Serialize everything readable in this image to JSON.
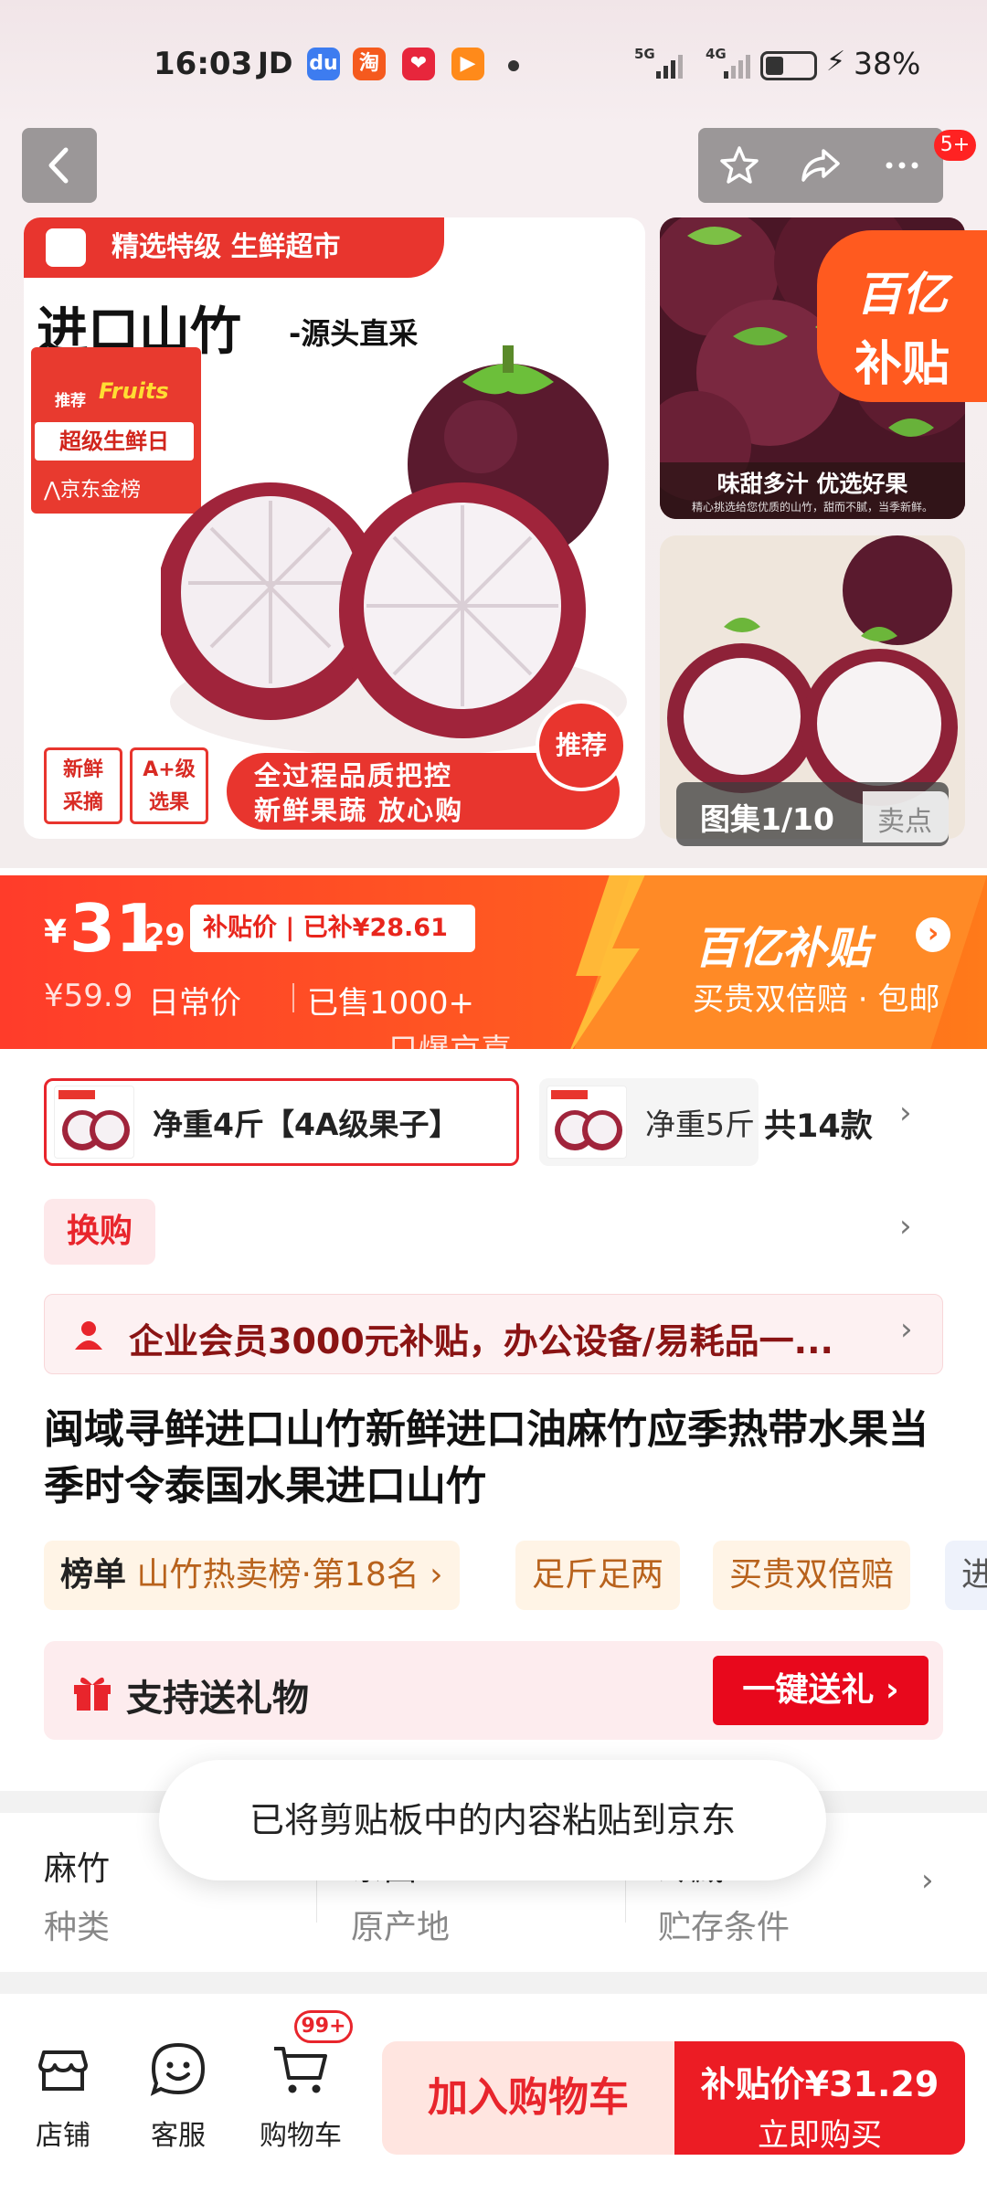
{
  "status_bar": {
    "time": "16:03",
    "carrier_app": "JD",
    "apps": [
      "du",
      "淘",
      "❤",
      "▶"
    ],
    "net1": "5G",
    "net2": "4G",
    "battery": "38%",
    "battery_level": 0.38
  },
  "nav": {
    "back_icon": "chevron-left-icon",
    "star_icon": "star-icon",
    "share_icon": "share-icon",
    "more_icon": "more-icon",
    "badge": "5+"
  },
  "gallery": {
    "main_tag": "精选特级 生鲜超市",
    "main_title": "进口山竹",
    "main_subtitle": "-源头直采",
    "badge_recommend": "推荐",
    "badge_fruits": "Fruits",
    "badge_day": "超级生鲜日",
    "badge_jd": "⋀京东金榜",
    "promo_left_1": "新鲜\n采摘",
    "promo_left_2": "A+级\n选果",
    "promo_right_1": "全过程品质把控",
    "promo_right_2": "新鲜果蔬 放心购",
    "promo_rec": "推荐",
    "thumb1_caption": "味甜多汁 优选好果",
    "thumb1_small": "精心挑选给您优质的山竹，甜而不腻，当季新鲜。",
    "subsidy_l1": "百亿",
    "subsidy_l2": "补贴",
    "album": "图集1/10",
    "selling_points": "卖点"
  },
  "price": {
    "currency": "¥",
    "integer": "31",
    "decimal": ".29",
    "tag": "补贴价 | 已补¥28.61",
    "original": "¥59.9",
    "original_label": "日常价",
    "sold": "已售1000+",
    "subsidy_title": "百亿补贴",
    "subsidy_arrow": "›",
    "subsidy_desc": "买贵双倍赔 · 包邮",
    "marquee": "只爆京喜"
  },
  "variants": {
    "selected": "净重4斤【4A级果子】",
    "second": "净重5斤",
    "count": "共14款"
  },
  "swap_label": "换购",
  "member_banner": "企业会员3000元补贴，办公设备/易耗品一...",
  "title": "闽域寻鲜进口山竹新鲜进口油麻竹应季热带水果当季时令泰国水果进口山竹",
  "tags": [
    {
      "bold": "榜单",
      "text": "山竹热卖榜·第18名 ›"
    },
    {
      "bold": "",
      "text": "足斤足两"
    },
    {
      "bold": "",
      "text": "买贵双倍赔"
    },
    {
      "bold": "",
      "text": "进"
    }
  ],
  "gift": {
    "label": "支持送礼物",
    "button": "一键送礼 ›"
  },
  "specs": [
    {
      "value": "麻竹",
      "key": "种类"
    },
    {
      "value": "泰国",
      "key": "原产地"
    },
    {
      "value": "冷藏",
      "key": "贮存条件"
    }
  ],
  "toast": "已将剪贴板中的内容粘贴到京东",
  "bottom": {
    "store": "店铺",
    "service": "客服",
    "cart": "购物车",
    "cart_badge": "99+",
    "add_to_cart": "加入购物车",
    "buy_price": "补贴价¥31.29",
    "buy_now": "立即购买"
  },
  "colors": {
    "brand_red": "#e8252c",
    "subsidy_orange": "#ff5a21"
  }
}
